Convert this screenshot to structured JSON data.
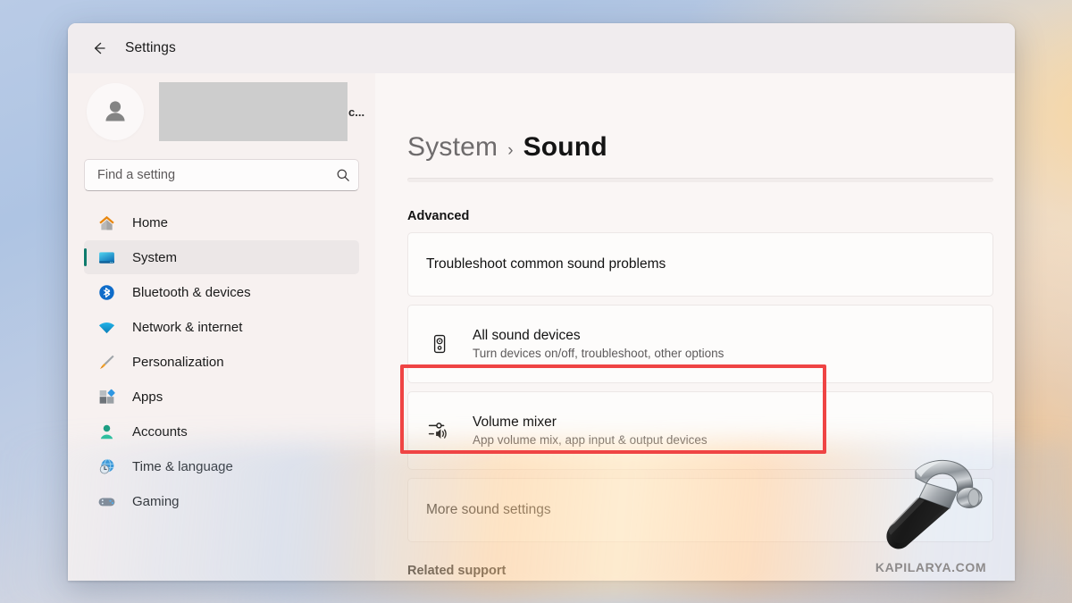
{
  "window": {
    "app_title": "Settings",
    "back_icon": "back-arrow-icon"
  },
  "sidebar": {
    "account": {
      "avatar_icon": "person-avatar-icon",
      "name_redacted": true,
      "name_tail": "c..."
    },
    "search": {
      "placeholder": "Find a setting",
      "value": "",
      "icon": "search-icon"
    },
    "items": [
      {
        "label": "Home",
        "icon": "home-icon",
        "selected": false
      },
      {
        "label": "System",
        "icon": "monitor-icon",
        "selected": true
      },
      {
        "label": "Bluetooth & devices",
        "icon": "bluetooth-icon",
        "selected": false
      },
      {
        "label": "Network & internet",
        "icon": "wifi-icon",
        "selected": false
      },
      {
        "label": "Personalization",
        "icon": "paintbrush-icon",
        "selected": false
      },
      {
        "label": "Apps",
        "icon": "apps-grid-icon",
        "selected": false
      },
      {
        "label": "Accounts",
        "icon": "person-icon",
        "selected": false
      },
      {
        "label": "Time & language",
        "icon": "clock-globe-icon",
        "selected": false
      },
      {
        "label": "Gaming",
        "icon": "gamepad-icon",
        "selected": false
      }
    ]
  },
  "main": {
    "breadcrumb": {
      "parent": "System",
      "separator": "›",
      "current": "Sound"
    },
    "section_heading": "Advanced",
    "cards": [
      {
        "title": "Troubleshoot common sound problems",
        "subtitle": "",
        "icon": "",
        "highlighted": false
      },
      {
        "title": "All sound devices",
        "subtitle": "Turn devices on/off, troubleshoot, other options",
        "icon": "speaker-device-icon",
        "highlighted": false
      },
      {
        "title": "Volume mixer",
        "subtitle": "App volume mix, app input & output devices",
        "icon": "volume-mixer-icon",
        "highlighted": true
      },
      {
        "title": "More sound settings",
        "subtitle": "",
        "icon": "",
        "highlighted": false
      }
    ],
    "related_heading": "Related support"
  },
  "watermark": {
    "text": "KAPILARYA.COM",
    "icon": "hammer-icon"
  },
  "colors": {
    "accent_selected": "#0f7b6c",
    "highlight_red": "#ef4444",
    "window_bg": "#f3eff0",
    "sidebar_bg": "#f7f1f0",
    "main_bg": "#faf6f5",
    "card_bg": "#fdfcfb"
  }
}
